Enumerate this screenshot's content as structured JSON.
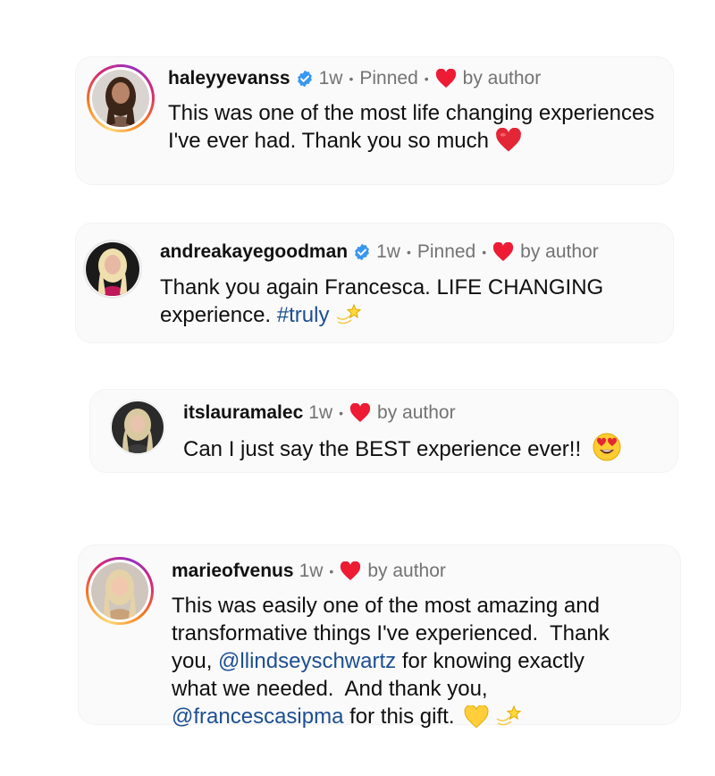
{
  "comments": [
    {
      "username": "haleyyevanss",
      "verified": true,
      "time": "1w",
      "pinned": "Pinned",
      "liked_by": "by author",
      "text": "This was one of the most life changing experiences I've ever had. Thank you so much",
      "trailing_emoji": "red-heart"
    },
    {
      "username": "andreakayegoodman",
      "verified": true,
      "time": "1w",
      "pinned": "Pinned",
      "liked_by": "by author",
      "text_part1": "Thank you again Francesca. LIFE CHANGING",
      "text_part2": "experience.",
      "hashtag": "#truly",
      "trailing_emoji": "dizzy-star"
    },
    {
      "username": "itslauramalec",
      "verified": false,
      "time": "1w",
      "liked_by": "by author",
      "text": "Can I just say the BEST experience ever!!",
      "trailing_emoji": "heart-eyes-face"
    },
    {
      "username": "marieofvenus",
      "verified": false,
      "time": "1w",
      "liked_by": "by author",
      "text_line1": "This was easily one of the most amazing and",
      "text_line2": "transformative things I've experienced.  Thank",
      "text_line3_pre": "you,",
      "mention1": "@llindseyschwartz",
      "text_line3_post": "for knowing exactly",
      "text_line4": "what we needed.  And thank you,",
      "mention2": "@francescasipma",
      "text_line5_post": "for this gift.",
      "trailing_emojis": [
        "yellow-heart",
        "dizzy-star"
      ]
    }
  ],
  "colors": {
    "username": "#111111",
    "meta": "#737373",
    "link": "#1d4f91",
    "heart": "#ed1b34",
    "verified": "#3897f0"
  }
}
